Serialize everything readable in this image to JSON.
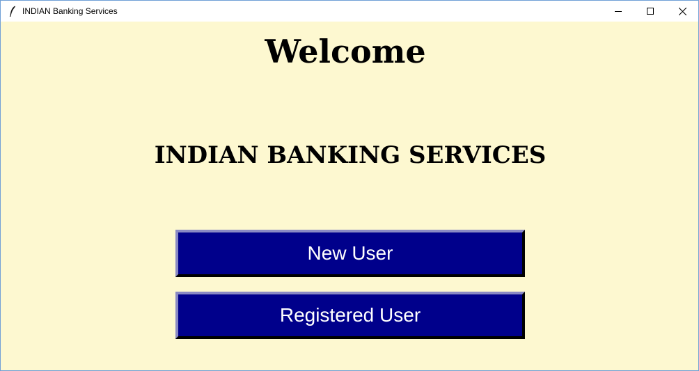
{
  "window": {
    "title": "INDIAN Banking Services",
    "icon": "feather-icon",
    "controls": [
      "minimize-icon",
      "maximize-icon",
      "close-icon"
    ]
  },
  "main": {
    "heading": "Welcome",
    "subheading": "INDIAN BANKING SERVICES",
    "buttons": {
      "new_user": "New User",
      "registered_user": "Registered User"
    }
  },
  "colors": {
    "background": "#fdf8d0",
    "button": "#00008b",
    "button_text": "#ffffff"
  }
}
